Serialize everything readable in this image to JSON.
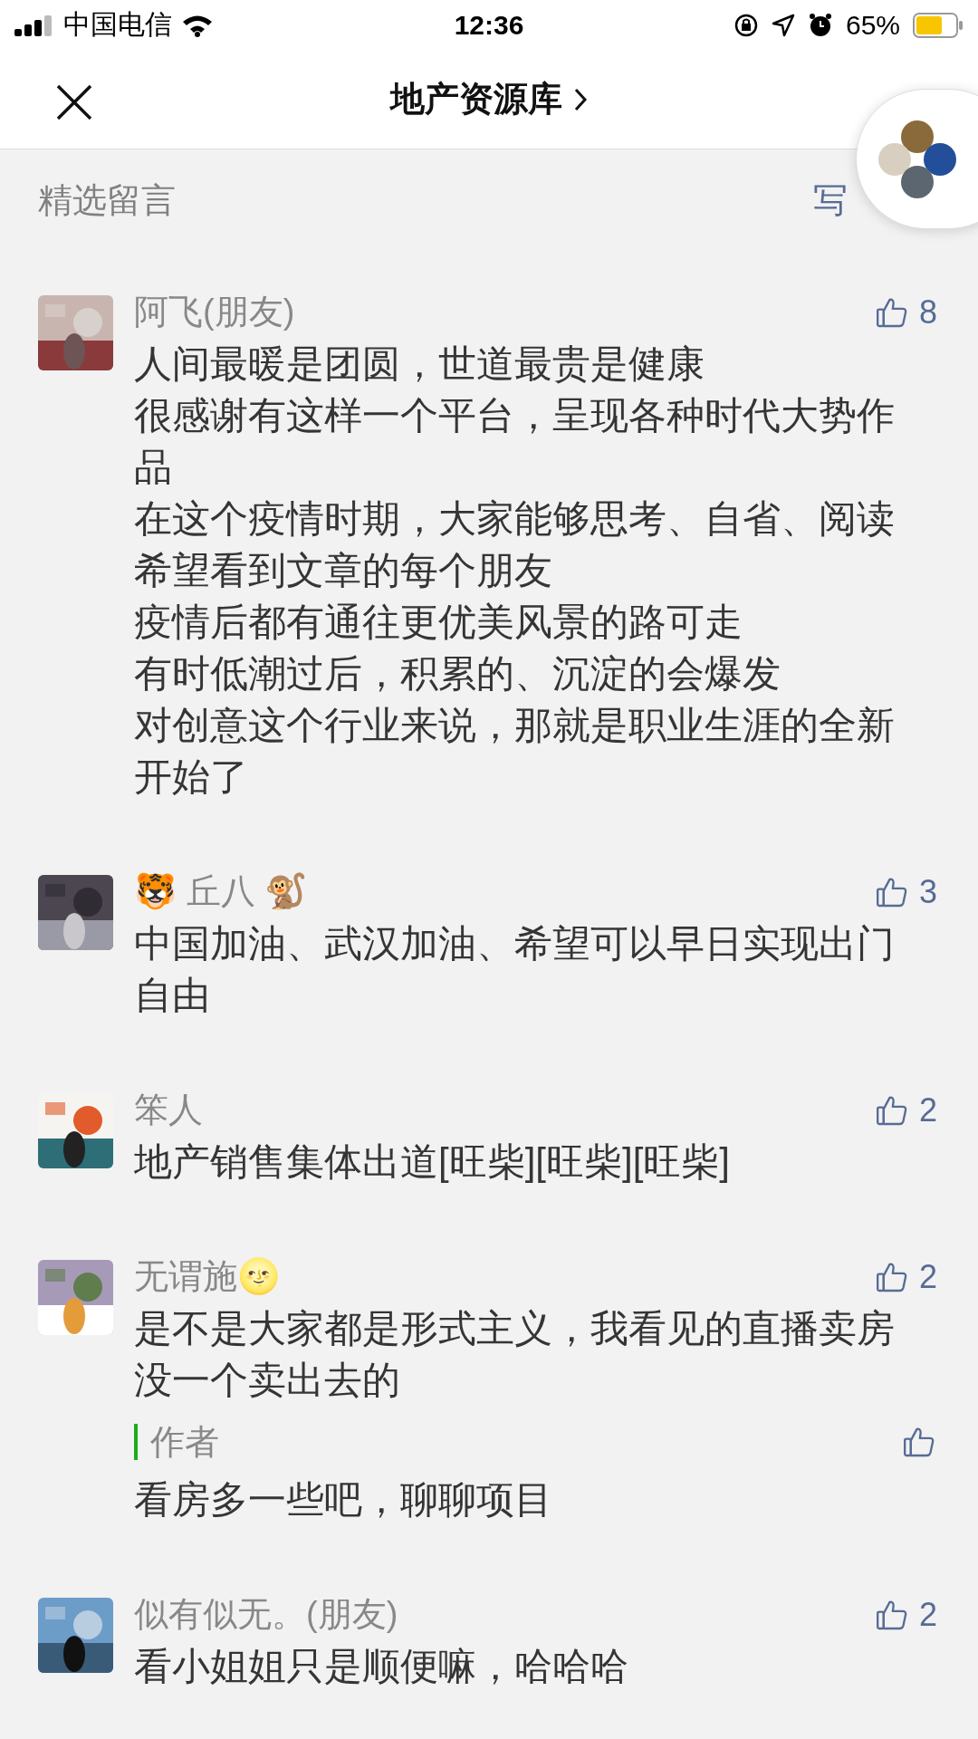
{
  "status_bar": {
    "carrier": "中国电信",
    "time": "12:36",
    "battery": "65%"
  },
  "nav": {
    "title": "地产资源库"
  },
  "section": {
    "title": "精选留言",
    "action": "写"
  },
  "comments": [
    {
      "name": "阿飞(朋友)",
      "likes": "8",
      "lines": [
        "人间最暖是团圆，世道最贵是健康",
        "很感谢有这样一个平台，呈现各种时代大势作",
        "品",
        "在这个疫情时期，大家能够思考、自省、阅读",
        "希望看到文章的每个朋友",
        "疫情后都有通往更优美风景的路可走",
        "有时低潮过后，积累的、沉淀的会爆发",
        "对创意这个行业来说，那就是职业生涯的全新",
        "开始了"
      ]
    },
    {
      "name": "🐯 丘八 🐒",
      "likes": "3",
      "lines": [
        "中国加油、武汉加油、希望可以早日实现出门",
        "自由"
      ]
    },
    {
      "name": "笨人",
      "likes": "2",
      "lines": [
        "地产销售集体出道[旺柴][旺柴][旺柴]"
      ]
    },
    {
      "name": "无谓施🌝",
      "likes": "2",
      "lines": [
        "是不是大家都是形式主义，我看见的直播卖房",
        "没一个卖出去的"
      ],
      "reply": {
        "label": "作者",
        "lines": [
          "看房多一些吧，聊聊项目"
        ]
      }
    },
    {
      "name": "似有似无。(朋友)",
      "likes": "2",
      "lines": [
        "看小姐姐只是顺便嘛，哈哈哈"
      ]
    }
  ]
}
